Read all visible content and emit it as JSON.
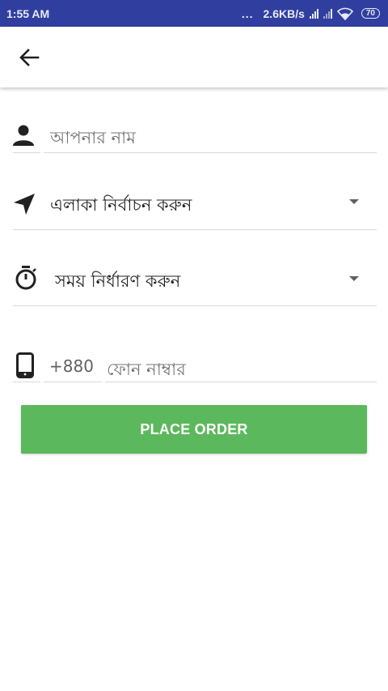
{
  "status_bar": {
    "time": "1:55 AM",
    "dots": "...",
    "speed": "2.6KB/s",
    "battery": "70"
  },
  "app_bar": {
    "back_icon": "arrow-left-icon"
  },
  "form": {
    "name": {
      "icon": "person-icon",
      "placeholder": "আপনার নাম"
    },
    "area": {
      "icon": "navigation-arrow-icon",
      "value": "এলাকা নির্বাচন করুন"
    },
    "time": {
      "icon": "stopwatch-icon",
      "value": "সময় নির্ধারণ করুন"
    },
    "phone": {
      "icon": "smartphone-icon",
      "country_code": "+880",
      "placeholder": "ফোন নাম্বার"
    }
  },
  "buttons": {
    "place_order": "PLACE ORDER"
  },
  "colors": {
    "status_bar": "#303F9F",
    "button": "#5CB85C",
    "text": "#212121",
    "placeholder": "#757575",
    "divider": "#d9d9d9"
  }
}
